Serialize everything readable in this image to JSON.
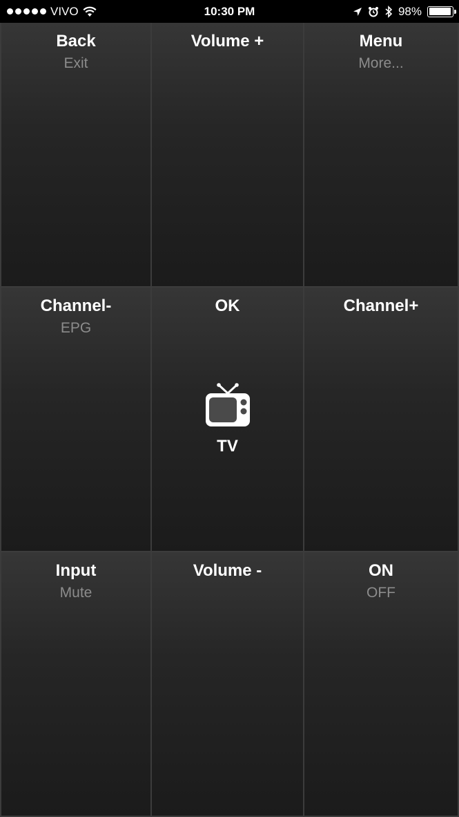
{
  "status_bar": {
    "carrier": "VIVO",
    "time": "10:30 PM",
    "battery": "98%",
    "battery_level": 0.98,
    "icons": [
      "signal-dots",
      "wifi-icon",
      "location-icon",
      "alarm-icon",
      "bluetooth-icon",
      "battery-icon"
    ]
  },
  "remote": {
    "buttons": [
      {
        "main": "Back",
        "sub": "Exit"
      },
      {
        "main": "Volume +",
        "sub": ""
      },
      {
        "main": "Menu",
        "sub": "More..."
      },
      {
        "main": "Channel-",
        "sub": "EPG"
      },
      {
        "main": "OK",
        "sub": ""
      },
      {
        "main": "Channel+",
        "sub": ""
      },
      {
        "main": "Input",
        "sub": "Mute"
      },
      {
        "main": "Volume -",
        "sub": ""
      },
      {
        "main": "ON",
        "sub": "OFF"
      }
    ],
    "center_device": {
      "label": "TV",
      "icon": "tv-icon"
    }
  },
  "colors": {
    "accent": "#ffffff",
    "secondary_text": "#8c8c8c",
    "background_top": "#363636",
    "background_bottom": "#1b1b1b"
  }
}
